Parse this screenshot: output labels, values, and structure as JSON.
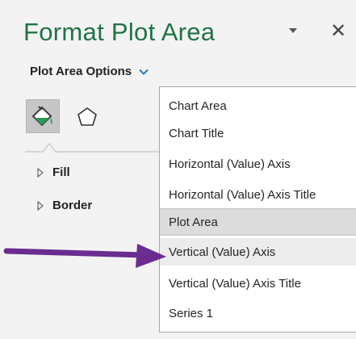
{
  "pane": {
    "title": "Format Plot Area",
    "close_glyph": "✕",
    "options_label": "Plot Area Options",
    "icons": [
      "fill-and-line-icon",
      "effects-pentagon-icon",
      "chevron-down-icon"
    ]
  },
  "sections": [
    {
      "label": "Fill"
    },
    {
      "label": "Border"
    }
  ],
  "dropdown": {
    "items": [
      {
        "label": "Chart Area"
      },
      {
        "label": "Chart Title"
      },
      {
        "label": "Horizontal (Value) Axis"
      },
      {
        "label": "Horizontal (Value) Axis Title"
      },
      {
        "label": "Plot Area"
      },
      {
        "label": "Vertical (Value) Axis"
      },
      {
        "label": "Vertical (Value) Axis Title"
      },
      {
        "label": "Series 1"
      }
    ],
    "selected": "Plot Area",
    "pointed_at": "Vertical (Value) Axis"
  },
  "colors": {
    "title": "#217346",
    "accent_chevron": "#2e75b6",
    "annotation_arrow": "#6a2c91",
    "selected_bg": "#dcdcdc"
  }
}
